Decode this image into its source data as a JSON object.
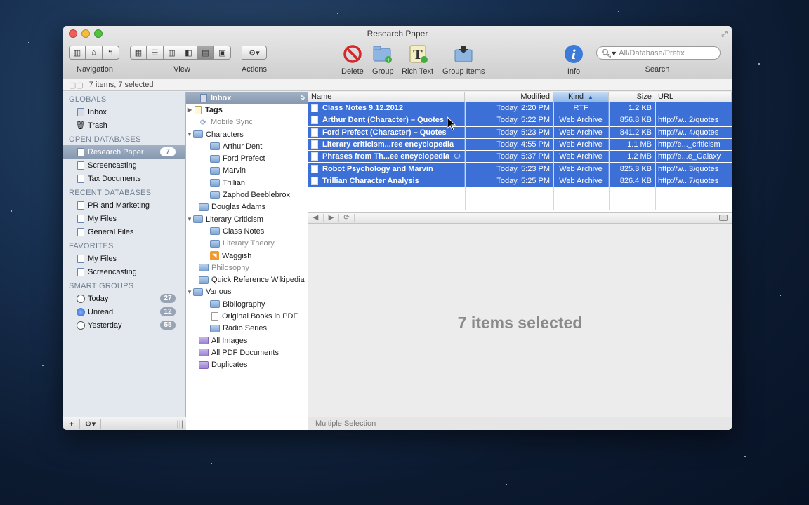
{
  "window": {
    "title": "Research Paper"
  },
  "toolbar": {
    "navigation_label": "Navigation",
    "view_label": "View",
    "actions_label": "Actions",
    "delete_label": "Delete",
    "group_label": "Group",
    "rich_text_label": "Rich Text",
    "group_items_label": "Group Items",
    "info_label": "Info",
    "search_label": "Search",
    "search_placeholder": "All/Database/Prefix"
  },
  "status": {
    "text": "7 items, 7 selected"
  },
  "sidebar": {
    "globals_header": "GLOBALS",
    "globals": [
      {
        "label": "Inbox"
      },
      {
        "label": "Trash"
      }
    ],
    "open_header": "OPEN DATABASES",
    "open": [
      {
        "label": "Research Paper",
        "badge": "7"
      },
      {
        "label": "Screencasting"
      },
      {
        "label": "Tax Documents"
      }
    ],
    "recent_header": "RECENT DATABASES",
    "recent": [
      {
        "label": "PR and Marketing"
      },
      {
        "label": "My Files"
      },
      {
        "label": "General Files"
      }
    ],
    "favorites_header": "FAVORITES",
    "favorites": [
      {
        "label": "My Files"
      },
      {
        "label": "Screencasting"
      }
    ],
    "smart_header": "SMART GROUPS",
    "smart": [
      {
        "label": "Today",
        "badge": "27"
      },
      {
        "label": "Unread",
        "badge": "12"
      },
      {
        "label": "Yesterday",
        "badge": "55"
      }
    ]
  },
  "tree": {
    "inbox": {
      "label": "Inbox",
      "count": "5"
    },
    "tags": "Tags",
    "mobile_sync": "Mobile Sync",
    "characters": "Characters",
    "arthur": "Arthur Dent",
    "ford": "Ford Prefect",
    "marvin": "Marvin",
    "trillian": "Trillian",
    "zaphod": "Zaphod Beeblebrox",
    "douglas": "Douglas Adams",
    "literary": "Literary Criticism",
    "class_notes": "Class Notes",
    "literary_theory": "Literary Theory",
    "waggish": "Waggish",
    "philosophy": "Philosophy",
    "quick_ref": "Quick Reference Wikipedia",
    "various": "Various",
    "bibliography": "Bibliography",
    "original_books": "Original Books in PDF",
    "radio": "Radio Series",
    "all_images": "All Images",
    "all_pdf": "All PDF Documents",
    "duplicates": "Duplicates"
  },
  "table": {
    "columns": {
      "name": "Name",
      "modified": "Modified",
      "kind": "Kind",
      "size": "Size",
      "url": "URL"
    },
    "rows": [
      {
        "name": "Class Notes 9.12.2012",
        "modified": "Today, 2:20 PM",
        "kind": "RTF",
        "size": "1.2 KB",
        "url": ""
      },
      {
        "name": "Arthur Dent (Character) – Quotes",
        "modified": "Today, 5:22 PM",
        "kind": "Web Archive",
        "size": "856.8 KB",
        "url": "http://w...2/quotes"
      },
      {
        "name": "Ford Prefect (Character) – Quotes",
        "modified": "Today, 5:23 PM",
        "kind": "Web Archive",
        "size": "841.2 KB",
        "url": "http://w...4/quotes"
      },
      {
        "name": "Literary criticism...ree encyclopedia",
        "modified": "Today, 4:55 PM",
        "kind": "Web Archive",
        "size": "1.1 MB",
        "url": "http://e..._criticism"
      },
      {
        "name": "Phrases from Th...ee encyclopedia",
        "modified": "Today, 5:37 PM",
        "kind": "Web Archive",
        "size": "1.2 MB",
        "url": "http://e...e_Galaxy"
      },
      {
        "name": "Robot Psychology and Marvin",
        "modified": "Today, 5:23 PM",
        "kind": "Web Archive",
        "size": "825.3 KB",
        "url": "http://w...3/quotes"
      },
      {
        "name": "Trillian Character Analysis",
        "modified": "Today, 5:25 PM",
        "kind": "Web Archive",
        "size": "826.4 KB",
        "url": "http://w...7/quotes"
      }
    ]
  },
  "preview": {
    "message": "7 items selected",
    "footer": "Multiple Selection"
  }
}
